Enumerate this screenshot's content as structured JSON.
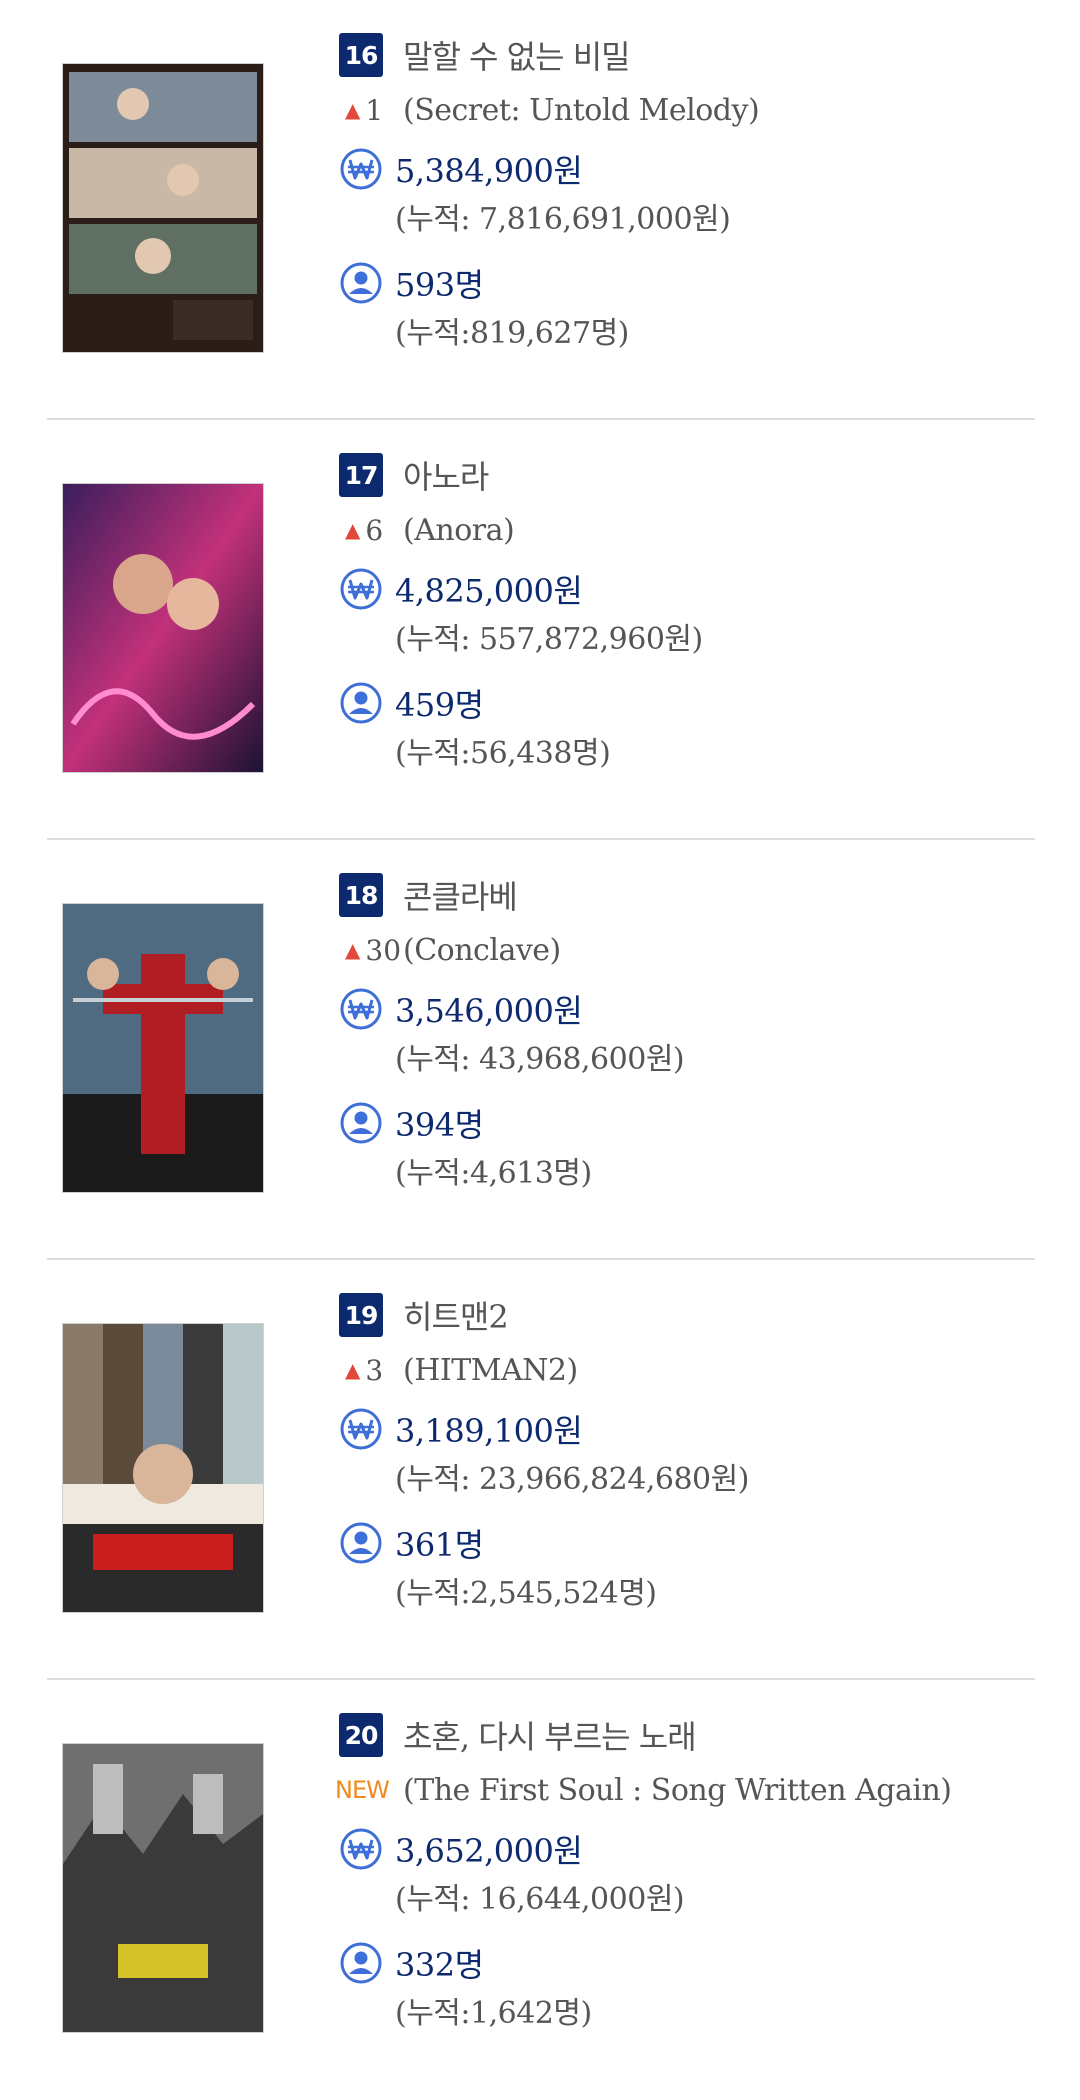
{
  "items": [
    {
      "rank": "16",
      "title": "말할 수 없는 비밀",
      "change": {
        "type": "up",
        "text": "1"
      },
      "original_title": "(Secret: Untold Melody)",
      "sales": "5,384,900원",
      "sales_cumulative": "(누적: 7,816,691,000원)",
      "audience": "593명",
      "audience_cumulative": "(누적:819,627명)",
      "poster": {
        "name": "poster-secret-untold-melody",
        "palette": [
          "#3a2d28",
          "#7d8a9a",
          "#c9b8a6",
          "#2b1e18"
        ]
      }
    },
    {
      "rank": "17",
      "title": "아노라",
      "change": {
        "type": "up",
        "text": "6"
      },
      "original_title": "(Anora)",
      "sales": "4,825,000원",
      "sales_cumulative": "(누적: 557,872,960원)",
      "audience": "459명",
      "audience_cumulative": "(누적:56,438명)",
      "poster": {
        "name": "poster-anora",
        "palette": [
          "#3a1e5c",
          "#c2317a",
          "#e86fb0",
          "#1b1233"
        ]
      }
    },
    {
      "rank": "18",
      "title": "콘클라베",
      "change": {
        "type": "up",
        "text": "30"
      },
      "original_title": "(Conclave)",
      "sales": "3,546,000원",
      "sales_cumulative": "(누적: 43,968,600원)",
      "audience": "394명",
      "audience_cumulative": "(누적:4,613명)",
      "poster": {
        "name": "poster-conclave",
        "palette": [
          "#4f6b82",
          "#b01e23",
          "#1b1b1b",
          "#c7d0d6"
        ]
      }
    },
    {
      "rank": "19",
      "title": "히트맨2",
      "change": {
        "type": "up",
        "text": "3"
      },
      "original_title": "(HITMAN2)",
      "sales": "3,189,100원",
      "sales_cumulative": "(누적: 23,966,824,680원)",
      "audience": "361명",
      "audience_cumulative": "(누적:2,545,524명)",
      "poster": {
        "name": "poster-hitman2",
        "palette": [
          "#2a2a2a",
          "#c81e1e",
          "#8a7a6a",
          "#efe9e0"
        ]
      }
    },
    {
      "rank": "20",
      "title": "초혼, 다시 부르는 노래",
      "change": {
        "type": "new",
        "text": "NEW"
      },
      "original_title": "(The First Soul : Song Written Again)",
      "sales": "3,652,000원",
      "sales_cumulative": "(누적: 16,644,000원)",
      "audience": "332명",
      "audience_cumulative": "(누적:1,642명)",
      "poster": {
        "name": "poster-first-soul",
        "palette": [
          "#6f6f6f",
          "#3a3a3a",
          "#d6c22a",
          "#bdbdbd"
        ]
      }
    }
  ],
  "icons": {
    "sales": "won-icon",
    "audience": "user-icon",
    "change_up": "arrow-up-icon"
  },
  "colors": {
    "rank_bg": "#0e2a6e",
    "value": "#0e2a6e",
    "arrow": "#e2483a",
    "new": "#f08a1c",
    "icon": "#3e6fd8",
    "muted": "#555555"
  }
}
